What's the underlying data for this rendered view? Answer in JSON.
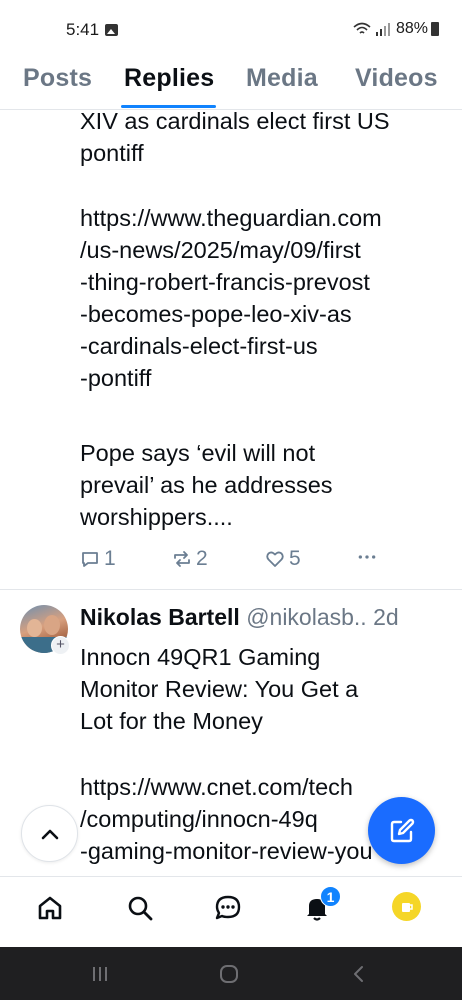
{
  "status_bar": {
    "time": "5:41",
    "battery": "88%",
    "icons": [
      "gallery-icon",
      "wifi-icon",
      "signal-icon",
      "battery-icon"
    ]
  },
  "tabs": [
    {
      "label": "Posts",
      "active": false
    },
    {
      "label": "Replies",
      "active": true
    },
    {
      "label": "Media",
      "active": false
    },
    {
      "label": "Videos",
      "active": false
    }
  ],
  "post1": {
    "text_top": "XIV as cardinals elect first US\npontiff",
    "link": "https://www.theguardian.com\n/us-news/2025/may/09/first\n-thing-robert-francis-prevost\n-becomes-pope-leo-xiv-as\n-cardinals-elect-first-us\n-pontiff",
    "excerpt": "Pope says ‘evil will not\nprevail’ as he addresses\nworshippers....",
    "replies": "1",
    "reposts": "2",
    "likes": "5",
    "more_icon": "more-icon"
  },
  "post2": {
    "author_name": "Nikolas Bartell",
    "author_handle": "@nikolasb..",
    "time_ago": "2d",
    "title": "Innocn 49QR1 Gaming\nMonitor Review: You Get a\nLot for the Money",
    "link": "https://www.cnet.com/tech\n/computing/innocn-49q\n-gaming-monitor-review-you"
  },
  "accent_color": "#1083fe",
  "compose_color": "#1a6cff",
  "bottom_nav": {
    "items": [
      "home-icon",
      "search-icon",
      "chat-icon",
      "bell-icon",
      "profile-avatar"
    ],
    "notification_count": "1"
  }
}
